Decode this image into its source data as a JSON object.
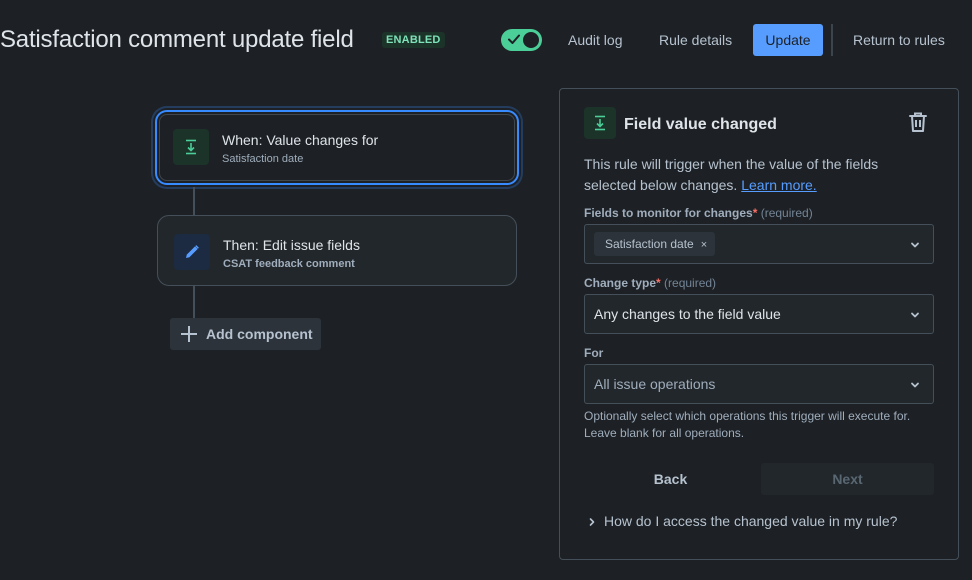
{
  "header": {
    "title": "Satisfaction comment update field",
    "badge": "ENABLED",
    "toggle_on": true,
    "audit_log": "Audit log",
    "rule_details": "Rule details",
    "update": "Update",
    "return": "Return to rules"
  },
  "flow": {
    "trigger": {
      "title": "When: Value changes for",
      "subtitle": "Satisfaction date",
      "icon": "field-download-icon"
    },
    "action": {
      "title": "Then: Edit issue fields",
      "subtitle": "CSAT feedback comment",
      "icon": "pencil-icon"
    },
    "add_component": "Add component"
  },
  "panel": {
    "title": "Field value changed",
    "description": "This rule will trigger when the value of the fields selected below changes.",
    "learn_more": "Learn more.",
    "fields_label": "Fields to monitor for changes",
    "required_star": "*",
    "required_text": "(required)",
    "fields_chip": "Satisfaction date",
    "chip_remove": "×",
    "change_type_label": "Change type",
    "change_type_value": "Any changes to the field value",
    "for_label": "For",
    "for_placeholder": "All issue operations",
    "helper": "Optionally select which operations this trigger will execute for. Leave blank for all operations.",
    "back": "Back",
    "next": "Next",
    "faq": "How do I access the changed value in my rule?"
  },
  "colors": {
    "background": "#1d2125",
    "accent": "#579dff",
    "success": "#4bce97",
    "danger": "#f87168"
  }
}
